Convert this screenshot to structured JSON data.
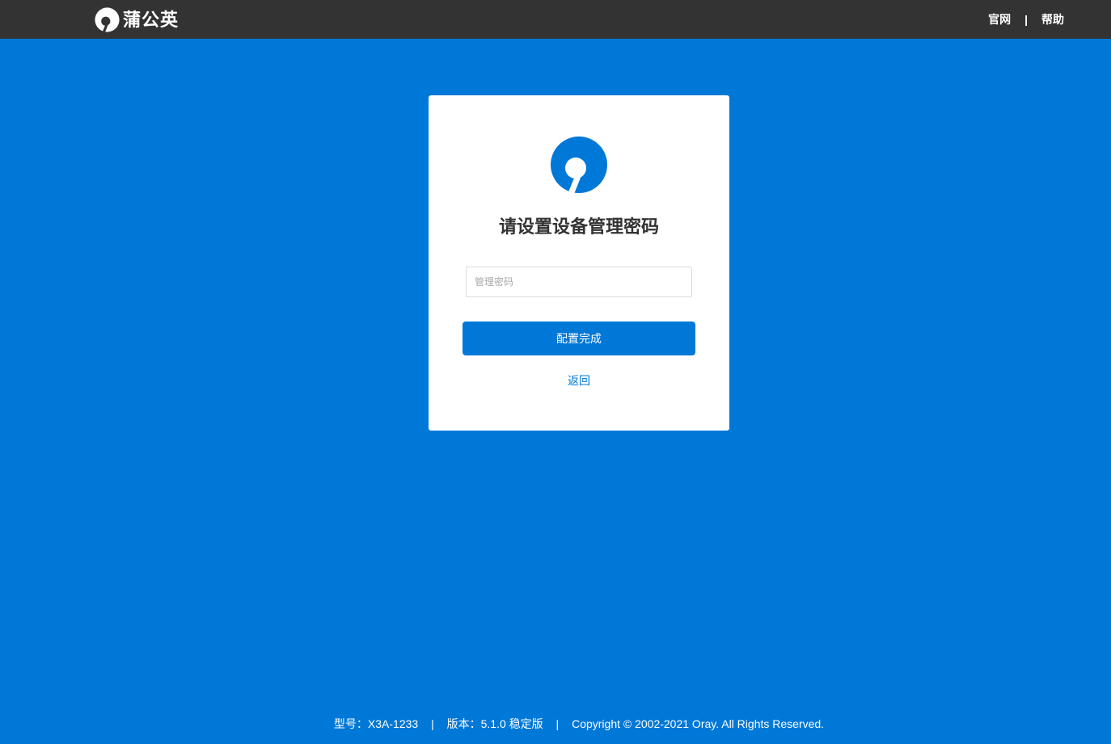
{
  "header": {
    "brand_name": "蒲公英",
    "brand_icon": "dandelion-logo-icon",
    "links": {
      "official_site": "官网",
      "separator": "|",
      "help": "帮助"
    }
  },
  "card": {
    "logo_icon": "dandelion-logo-icon",
    "title": "请设置设备管理密码",
    "password_placeholder": "管理密码",
    "password_value": "",
    "submit_label": "配置完成",
    "back_label": "返回"
  },
  "footer": {
    "model": "型号：X3A-1233",
    "separator": "|",
    "version": "版本：5.1.0 稳定版",
    "copyright": "Copyright © 2002-2021 Oray. All Rights Reserved."
  },
  "colors": {
    "background": "#0078d7",
    "topbar": "#333333",
    "accent": "#0078d7",
    "card": "#ffffff"
  }
}
